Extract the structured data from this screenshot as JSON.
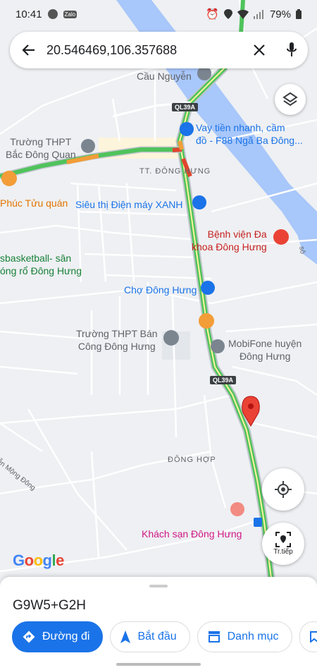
{
  "status_bar": {
    "time": "10:41",
    "app_icons": [
      "chrome-icon",
      "zalo-icon"
    ],
    "zalo_text": "Zalo",
    "battery": "79%"
  },
  "search": {
    "value": "20.546469,106.357688"
  },
  "map": {
    "road_shields": [
      "QL39A",
      "QL39A"
    ],
    "labels": {
      "cau_nguyen": "Cầu Nguyễn",
      "vay_tien": "Vay tiền nhanh, cầm\nđồ - F88 Ngã Ba Đông...",
      "truong_thpt_bac": "Trường THPT\nBắc Đông Quan",
      "tt_dong_hung": "TT. ĐÔNG HƯNG",
      "phuc_tuu_quan": "Phúc Tửu quán",
      "sieu_thi": "Siêu thị Điện máy XANH",
      "benh_vien": "Bệnh viện Đa\nkhoa Đông Hưng",
      "basketball": "sbasketball- sân\nóng rổ Đông Hưng",
      "cho_dong_hung": "Chợ Đông Hưng",
      "truong_thpt_ban": "Trường THPT Bán\nCông Đông Hưng",
      "mobifone": "MobiFone huyện\nĐông Hưng",
      "dong_hop": "ĐÔNG HỢP",
      "nguyen_mong_dong": "uyễn Mộng Đông",
      "khach_san": "Khách sạn Đông Hưng",
      "river_edge": "sô"
    },
    "colors": {
      "traffic_green": "#4fc35b",
      "traffic_red": "#e0452f",
      "traffic_orange": "#f29d38",
      "river": "#a8c7fa",
      "pin": "#ea4335"
    }
  },
  "controls": {
    "layers_icon": "layers-icon",
    "location_icon": "my-location-icon",
    "live_view_label": "Tr.tiếp"
  },
  "attribution": "Google",
  "sheet": {
    "plus_code": "G9W5+G2H",
    "actions": {
      "directions": "Đường đi",
      "start": "Bắt đầu",
      "catalog": "Danh mục"
    }
  }
}
